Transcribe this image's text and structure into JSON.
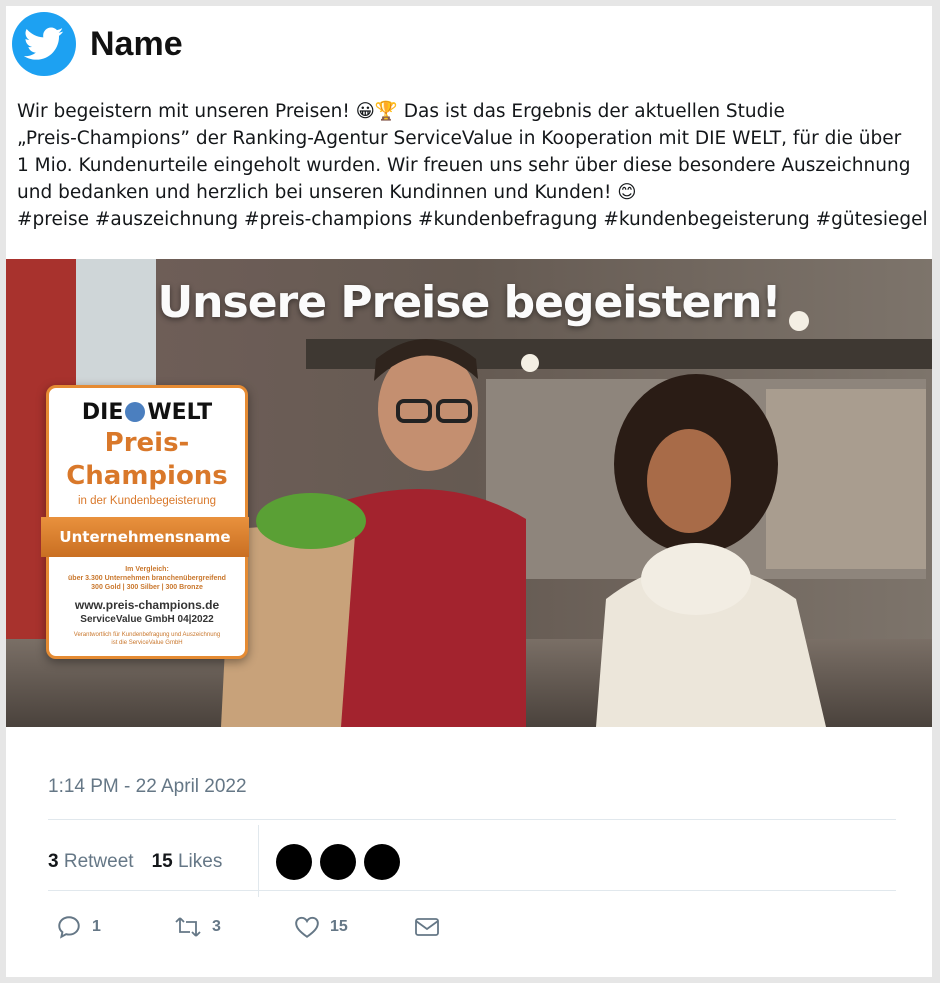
{
  "author": {
    "name": "Name"
  },
  "tweet": {
    "lines": [
      "Wir begeistern mit unseren Preisen! 😀🏆  Das ist das Ergebnis der aktuellen Studie",
      "„Preis-Champions” der Ranking-Agentur ServiceValue in Kooperation mit DIE WELT, für die über",
      "1 Mio. Kundenurteile eingeholt wurden. Wir freuen uns sehr über diese besondere Auszeichnung",
      "und bedanken und herzlich bei unseren Kundinnen und Kunden! 😊",
      "#preise #auszeichnung #preis-champions #kundenbefragung #kundenbegeisterung #gütesiegel"
    ]
  },
  "media": {
    "headline": "Unsere Preise begeistern!",
    "badge": {
      "brand_left": "DIE",
      "brand_right": "WELT",
      "title_1": "Preis-",
      "title_2": "Champions",
      "subtitle": "in der Kundenbegeisterung",
      "ribbon": "Unternehmensname",
      "compare_1": "Im Vergleich:",
      "compare_2": "über 3.300 Unternehmen branchenübergreifend",
      "compare_3": "300 Gold | 300 Silber | 300 Bronze",
      "url": "www.preis-champions.de",
      "servicevalue": "ServiceValue GmbH   04|2022",
      "footer_1": "Verantwortlich für Kundenbefragung und Auszeichnung",
      "footer_2": "ist die ServiceValue GmbH"
    }
  },
  "timestamp": "1:14 PM - 22 April 2022",
  "stats": {
    "retweets_count": "3",
    "retweets_label": "Retweet",
    "likes_count": "15",
    "likes_label": "Likes"
  },
  "actions": {
    "reply_count": "1",
    "retweet_count": "3",
    "like_count": "15"
  },
  "colors": {
    "brand": "#1da1f2",
    "badge_orange": "#e58b33",
    "muted": "#657786"
  },
  "icons": [
    "twitter-bird-icon",
    "reply-icon",
    "retweet-icon",
    "like-icon",
    "message-icon"
  ]
}
